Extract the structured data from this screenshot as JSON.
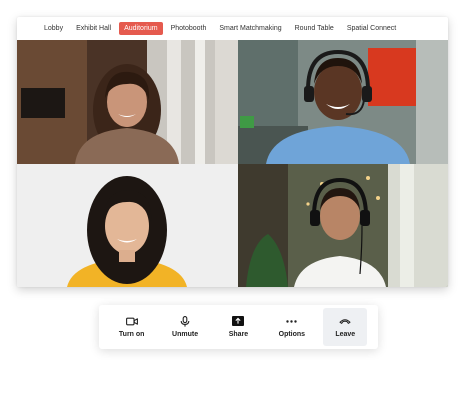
{
  "nav": {
    "tabs": [
      {
        "label": "Lobby",
        "active": false
      },
      {
        "label": "Exhibit Hall",
        "active": false
      },
      {
        "label": "Auditorium",
        "active": true
      },
      {
        "label": "Photobooth",
        "active": false
      },
      {
        "label": "Smart Matchmaking",
        "active": false
      },
      {
        "label": "Round Table",
        "active": false
      },
      {
        "label": "Spatial Connect",
        "active": false
      }
    ],
    "accent_color": "#e55a4e"
  },
  "participants": [
    {
      "tile": "top-left",
      "description_icon": "video-feed"
    },
    {
      "tile": "top-right",
      "description_icon": "video-feed"
    },
    {
      "tile": "bottom-left",
      "description_icon": "video-feed"
    },
    {
      "tile": "bottom-right",
      "description_icon": "video-feed"
    }
  ],
  "controls": {
    "turn_on": {
      "label": "Turn on",
      "icon": "camera-icon"
    },
    "unmute": {
      "label": "Unmute",
      "icon": "microphone-icon"
    },
    "share": {
      "label": "Share",
      "icon": "share-screen-icon"
    },
    "options": {
      "label": "Options",
      "icon": "more-icon"
    },
    "leave": {
      "label": "Leave",
      "icon": "hang-up-icon"
    }
  }
}
